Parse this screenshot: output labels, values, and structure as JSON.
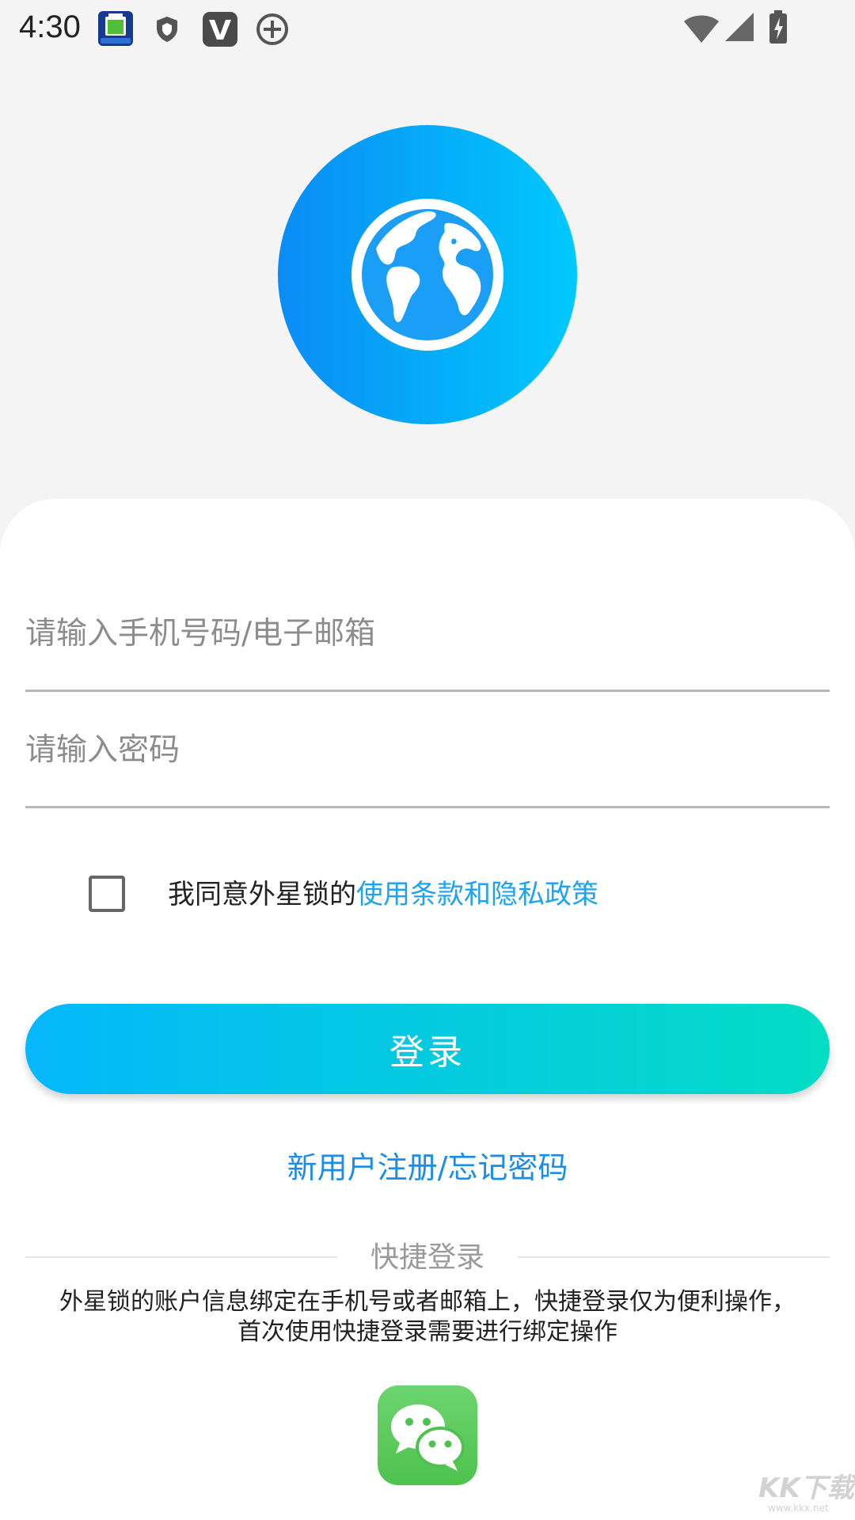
{
  "status_bar": {
    "time": "4:30",
    "notification_icons": [
      "battery-app-icon",
      "shield-icon",
      "v-app-icon",
      "plus-circle-icon"
    ],
    "system_icons": [
      "wifi-icon",
      "signal-icon",
      "battery-charging-icon"
    ]
  },
  "logo": {
    "icon": "globe-icon",
    "gradient_start": "#0a8cf5",
    "gradient_end": "#00c9fc"
  },
  "login_form": {
    "account_placeholder": "请输入手机号码/电子邮箱",
    "account_value": "",
    "password_placeholder": "请输入密码",
    "password_value": ""
  },
  "agreement": {
    "checked": false,
    "prefix": "我同意外星锁的",
    "link_text": "使用条款和隐私政策",
    "link_color": "#1fa3f0"
  },
  "login_button": {
    "label": "登录",
    "gradient_start": "#04b8fb",
    "gradient_end": "#04dcc5"
  },
  "register_link": {
    "label": "新用户注册/忘记密码",
    "color": "#1b8ce8"
  },
  "quick_login": {
    "title": "快捷登录",
    "note_line1": "外星锁的账户信息绑定在手机号或者邮箱上，快捷登录仅为便利操作，",
    "note_line2": "首次使用快捷登录需要进行绑定操作",
    "providers": [
      {
        "icon": "wechat-icon",
        "color": "#5ccb5e"
      }
    ]
  },
  "watermark": {
    "main": "KK下载",
    "sub": "www.kkx.net"
  }
}
